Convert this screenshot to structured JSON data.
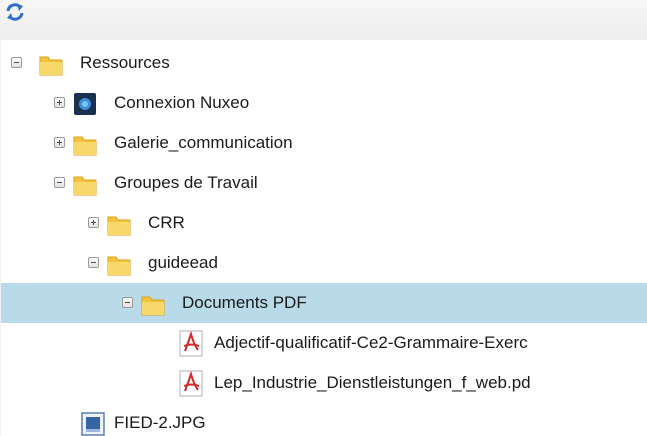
{
  "toolbar": {
    "refresh_icon": "refresh-icon"
  },
  "tree": {
    "items": [
      {
        "label": "Ressources",
        "icon": "folder-icon",
        "toggle": "collapse"
      },
      {
        "label": "Connexion Nuxeo",
        "icon": "nuxeo-icon",
        "toggle": "expand"
      },
      {
        "label": "Galerie_communication",
        "icon": "folder-icon",
        "toggle": "expand"
      },
      {
        "label": "Groupes de Travail",
        "icon": "folder-icon",
        "toggle": "collapse"
      },
      {
        "label": "CRR",
        "icon": "folder-icon",
        "toggle": "expand"
      },
      {
        "label": "guideead",
        "icon": "folder-icon",
        "toggle": "collapse"
      },
      {
        "label": "Documents PDF",
        "icon": "folder-icon",
        "toggle": "collapse",
        "selected": true
      },
      {
        "label": "Adjectif-qualificatif-Ce2-Grammaire-Exerc",
        "icon": "pdf-icon"
      },
      {
        "label": "Lep_Industrie_Dienstleistungen_f_web.pd",
        "icon": "pdf-icon"
      },
      {
        "label": "FIED-2.JPG",
        "icon": "image-file-icon"
      }
    ]
  },
  "colors": {
    "selection": "#b9dbe9",
    "folder": "#f2c33c",
    "pdf": "#d4282a"
  }
}
